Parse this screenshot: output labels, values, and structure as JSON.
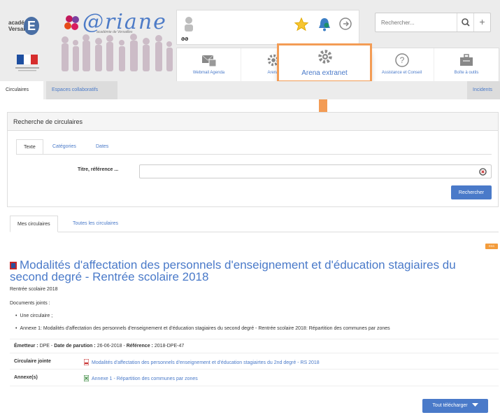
{
  "header": {
    "academy_label": "académie\nVersailles",
    "academy_letter": "E",
    "brand": "@riane",
    "brand_sub": "académie de Versailles",
    "user_tag": "ƏƏ",
    "search_placeholder": "Rechercher...",
    "plus_label": "+",
    "apps": [
      {
        "label": "Webmail Agenda",
        "icon": "mail-calendar-icon"
      },
      {
        "label": "Arena",
        "icon": "gear-icon"
      },
      {
        "label": "Assistance et Conseil",
        "icon": "help-icon"
      },
      {
        "label": "Boîte à outils",
        "icon": "toolbox-icon"
      }
    ],
    "highlight_label": "Arena extranet"
  },
  "tabs": {
    "circulaires": "Circulaires",
    "espaces": "Espaces collaboratifs",
    "incidents": "Incidents"
  },
  "search_panel": {
    "title": "Recherche de circulaires",
    "tab_texte": "Texte",
    "tab_categories": "Catégories",
    "tab_dates": "Dates",
    "field_label": "Titre, référence ...",
    "field_value": "",
    "search_button": "Rechercher"
  },
  "list_tabs": {
    "mine": "Mes circulaires",
    "all": "Toutes les circulaires"
  },
  "rss_label": "RSS",
  "circular": {
    "title": "Modalités d'affectation des personnels d'enseignement et d'éducation stagiaires du second degré - Rentrée scolaire 2018",
    "subtitle": "Rentrée scolaire 2018",
    "docs_label": "Documents joints :",
    "doc1": "Une circulaire ;",
    "doc2": "Annexe 1: Modalités d'affectation des personnels d'enseignement et d'éducation stagiaires du second degré - Rentrée scolaire 2018: Répartition des communes par zones",
    "meta_emetteur_label": "Émetteur :",
    "meta_emetteur": "DPE",
    "meta_date_label": "Date de parution :",
    "meta_date": "26-06-2018",
    "meta_ref_label": "Référence :",
    "meta_ref": "2018-DPE-47",
    "row1_key": "Circulaire jointe",
    "row1_value": "Modalités d'affectation des personnels d'enseignement et d'éducation stagiairtes du 2nd degré - RS 2018",
    "row2_key": "Annexe(s)",
    "row2_value": "Annexe 1 - Répartition des communes par zones",
    "download_button": "Tout télécharger"
  },
  "colors": {
    "accent": "#4a7ac9",
    "highlight": "#f39c55",
    "header_bg": "#ececec"
  }
}
